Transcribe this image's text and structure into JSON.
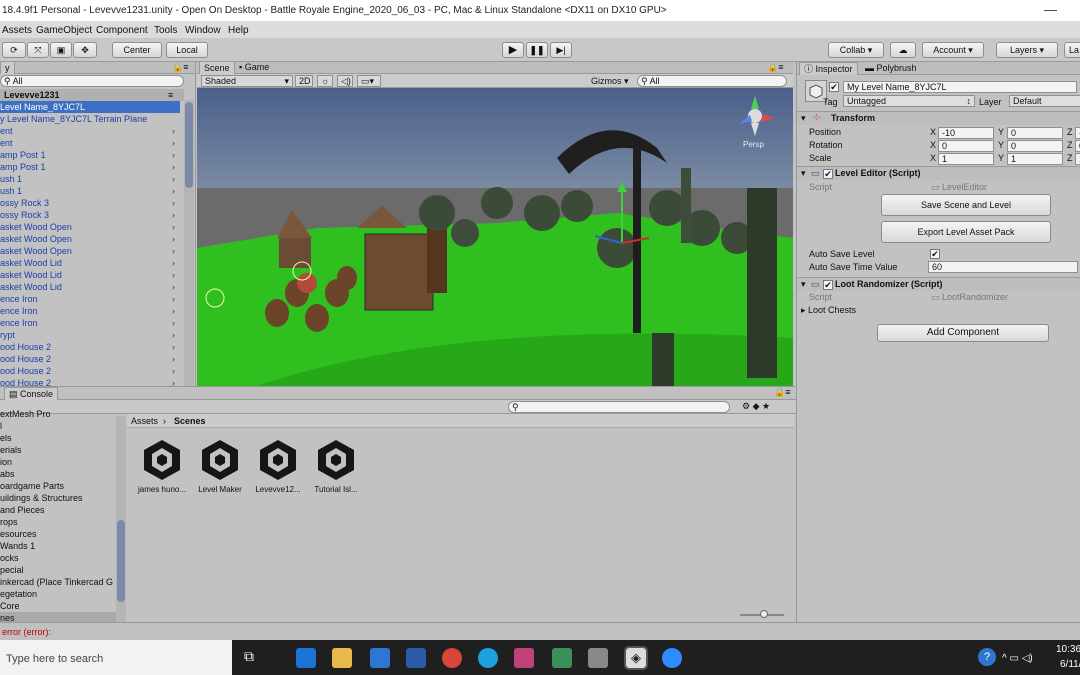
{
  "window": {
    "title": "18.4.9f1 Personal - Levevve1231.unity - Open On Desktop - Battle Royale Engine_2020_06_03 - PC, Mac & Linux Standalone <DX11 on DX10 GPU>",
    "minimize": "—"
  },
  "menu": [
    "Assets",
    "GameObject",
    "Component",
    "Tools",
    "Window",
    "Help"
  ],
  "toolbar": {
    "center": "Center",
    "local": "Local",
    "collab": "Collab",
    "account": "Account",
    "layers": "Layers",
    "layout": "La"
  },
  "hierarchy": {
    "tab": "y",
    "search_placeholder": "All",
    "scene_name": "Levevve1231",
    "items": [
      "Level Name_8YJC7L",
      "y Level Name_8YJC7L Terrain Plane",
      "ent",
      "ent",
      "amp Post 1",
      "amp Post 1",
      "ush 1",
      "ush 1",
      "ossy Rock 3",
      "ossy Rock 3",
      "asket Wood Open",
      "asket Wood Open",
      "asket Wood Open",
      "asket Wood Lid",
      "asket Wood Lid",
      "asket Wood Lid",
      "ence Iron",
      "ence Iron",
      "ence Iron",
      "rypt",
      "ood House 2",
      "ood House 2",
      "ood House 2",
      "ood House 2"
    ]
  },
  "scene": {
    "tabs": [
      "Scene",
      "Game"
    ],
    "shading": "Shaded",
    "mode_2d": "2D",
    "gizmos": "Gizmos",
    "search_placeholder": "All",
    "persp": "Persp"
  },
  "inspector": {
    "tabs": [
      "Inspector",
      "Polybrush"
    ],
    "object_name": "My Level Name_8YJC7L",
    "tag_label": "Tag",
    "tag_value": "Untagged",
    "layer_label": "Layer",
    "layer_value": "Default",
    "transform": {
      "title": "Transform",
      "rows": [
        {
          "label": "Position",
          "x": "-10",
          "y": "0",
          "z": "-"
        },
        {
          "label": "Rotation",
          "x": "0",
          "y": "0",
          "z": "0"
        },
        {
          "label": "Scale",
          "x": "1",
          "y": "1",
          "z": "1"
        }
      ]
    },
    "level_editor": {
      "title": "Level Editor (Script)",
      "script_label": "Script",
      "script_value": "LevelEditor",
      "save_button": "Save Scene and Level",
      "export_button": "Export Level Asset Pack",
      "auto_save_label": "Auto Save Level",
      "auto_save_time_label": "Auto Save Time Value",
      "auto_save_time_value": "60"
    },
    "loot": {
      "title": "Loot Randomizer (Script)",
      "script_label": "Script",
      "script_value": "LootRandomizer",
      "chests_label": "Loot Chests"
    },
    "add_component": "Add Component"
  },
  "console": {
    "tab": "Console"
  },
  "project": {
    "breadcrumb_root": "Assets",
    "breadcrumb_current": "Scenes",
    "folders": [
      "extMesh Pro",
      "l",
      "els",
      "erials",
      "ion",
      "abs",
      "oardgame Parts",
      "uildings & Structures",
      "and Pieces",
      "rops",
      "esources",
      "Wands 1",
      "ocks",
      "pecial",
      "inkercad (Place Tinkercad G",
      "egetation",
      "Core",
      "nes"
    ],
    "assets": [
      "james huno...",
      "Level Maker",
      "Levevve12...",
      "Tutorial Isl..."
    ]
  },
  "status": {
    "error": "error (error):"
  },
  "taskbar": {
    "search_placeholder": "Type here to search",
    "time": "10:36",
    "date": "6/11/2"
  },
  "colors": {
    "unity_grey": "#c2c2c2",
    "selection_blue": "#3d6fc4",
    "link_blue": "#1a3fa8",
    "terrain_green": "#2fbf1f",
    "taskbar": "#1f1f1f"
  }
}
